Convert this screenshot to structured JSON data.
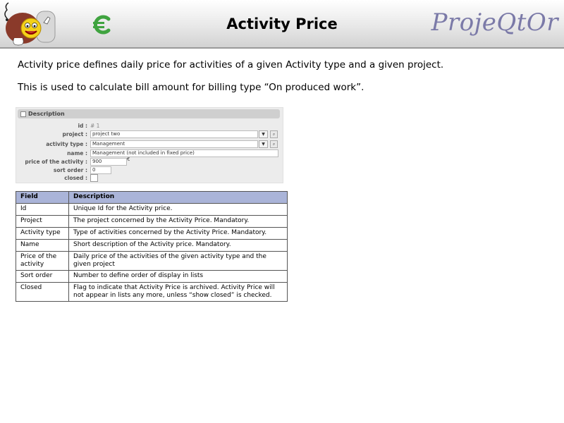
{
  "header": {
    "title": "Activity Price",
    "brand": "ProjeQtOr"
  },
  "intro": {
    "line1": "Activity price defines daily price for activities of a given Activity type and a given project.",
    "line2": "This is used to calculate bill amount for billing type “On produced work”."
  },
  "form": {
    "section_title": "Description",
    "id_label": "id :",
    "id_value": "# 1",
    "project_label": "project :",
    "project_value": "project two",
    "activity_type_label": "activity type :",
    "activity_type_value": "Management",
    "name_label": "name :",
    "name_value": "Management (not included in fixed price)",
    "price_label": "price of the activity :",
    "price_value": "900",
    "currency": "€",
    "sort_order_label": "sort order :",
    "sort_order_value": "0",
    "closed_label": "closed :"
  },
  "table": {
    "headers": [
      "Field",
      "Description"
    ],
    "rows": [
      {
        "field": "Id",
        "description": "Unique Id for the Activity price."
      },
      {
        "field": "Project",
        "description": "The project concerned by the Activity Price. Mandatory."
      },
      {
        "field": "Activity type",
        "description": "Type of activities concerned by the Activity Price. Mandatory."
      },
      {
        "field": "Name",
        "description": "Short description of the Activity price. Mandatory."
      },
      {
        "field": "Price of the activity",
        "description": "Daily price of the activities of the given activity type and the given project"
      },
      {
        "field": "Sort order",
        "description": "Number to define order of display in lists"
      },
      {
        "field": "Closed",
        "description": "Flag to indicate that Activity Price is archived. Activity Price will not appear in lists any more, unless “show closed” is checked."
      }
    ]
  }
}
